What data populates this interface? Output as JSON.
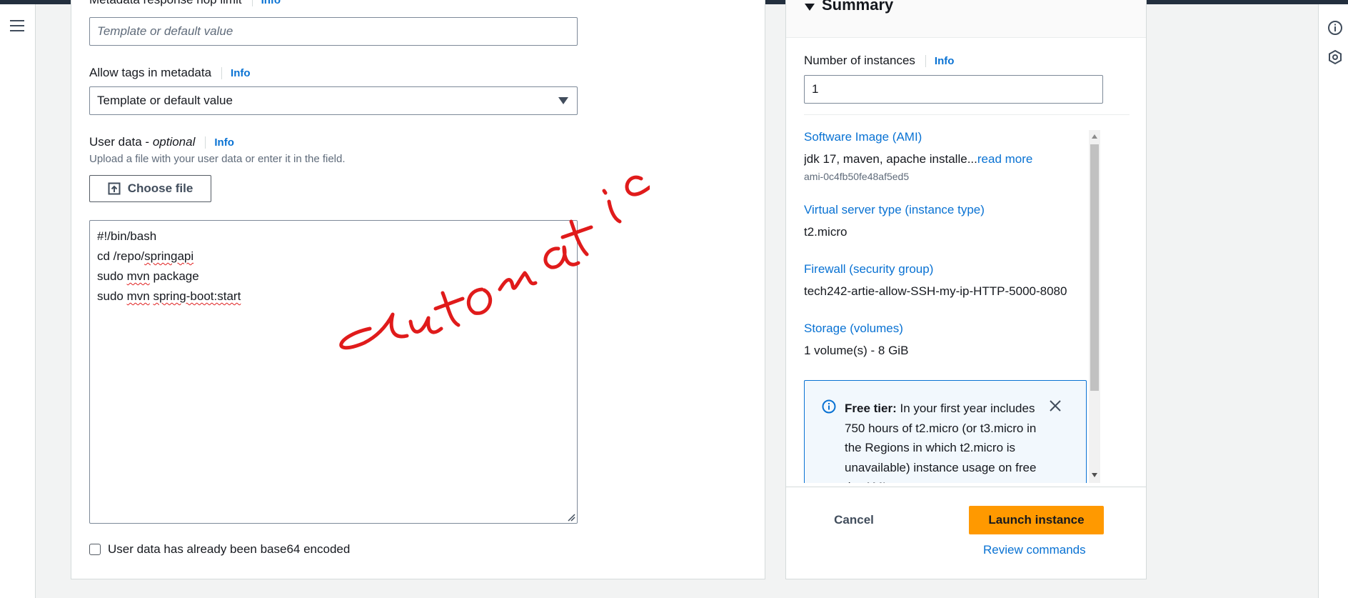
{
  "config": {
    "hop_limit_label": "Metadata response hop limit",
    "hop_limit_info": "Info",
    "hop_limit_placeholder": "Template or default value",
    "allow_tags_label": "Allow tags in metadata",
    "allow_tags_info": "Info",
    "allow_tags_value": "Template or default value",
    "user_data_label": "User data - ",
    "user_data_optional": "optional",
    "user_data_info": "Info",
    "user_data_desc": "Upload a file with your user data or enter it in the field.",
    "choose_file_label": "Choose file",
    "user_data_lines": [
      "#!/bin/bash",
      "cd /repo/springapi",
      "sudo mvn package",
      "sudo mvn spring-boot:start"
    ],
    "base64_label": "User data has already been base64 encoded"
  },
  "annotation": {
    "text": "automatic",
    "color": "#e01b1b"
  },
  "summary": {
    "title": "Summary",
    "instances_label": "Number of instances",
    "instances_info": "Info",
    "instances_value": "1",
    "ami_label": "Software Image (AMI)",
    "ami_value": "jdk 17, maven, apache installe...",
    "ami_read_more": "read more",
    "ami_id": "ami-0c4fb50fe48af5ed5",
    "instance_type_label": "Virtual server type (instance type)",
    "instance_type_value": "t2.micro",
    "firewall_label": "Firewall (security group)",
    "firewall_value": "tech242-artie-allow-SSH-my-ip-HTTP-5000-8080",
    "storage_label": "Storage (volumes)",
    "storage_value": "1 volume(s) - 8 GiB",
    "free_tier_title": "Free tier:",
    "free_tier_text": " In your first year includes 750 hours of t2.micro (or t3.micro in the Regions in which t2.micro is unavailable) instance usage on free tier AMIs",
    "cancel_label": "Cancel",
    "launch_label": "Launch instance",
    "review_label": "Review commands"
  },
  "colors": {
    "accent": "#0972d3",
    "primary_button": "#ff9900",
    "header_bar": "#232f3e"
  }
}
